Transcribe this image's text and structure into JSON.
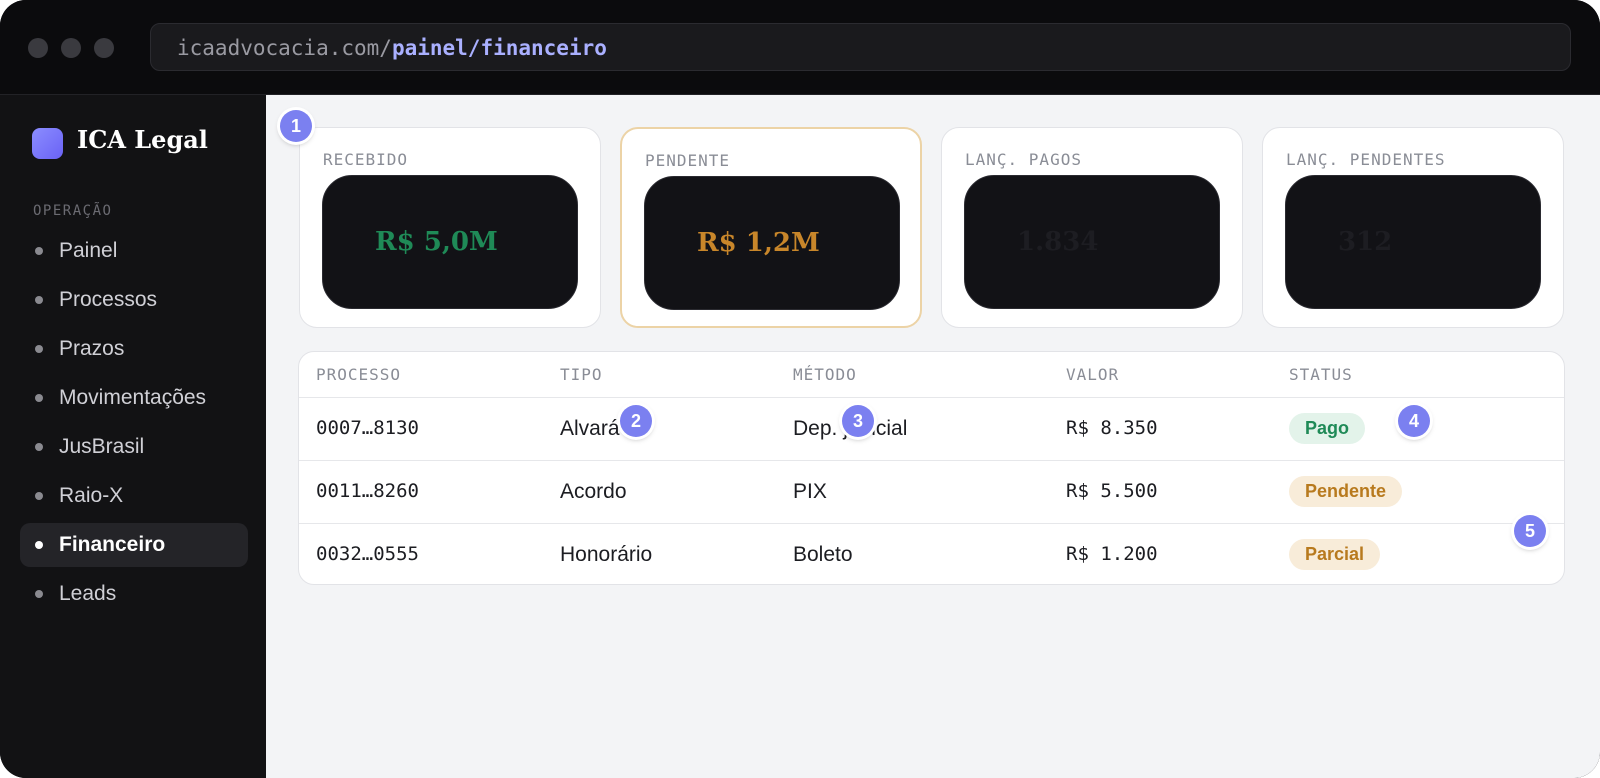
{
  "browser": {
    "url_host": "icaadvocacia.com/",
    "url_path": "painel/financeiro"
  },
  "sidebar": {
    "brand": "ICA Legal",
    "section": "OPERAÇÃO",
    "items": [
      {
        "label": "Painel",
        "active": false
      },
      {
        "label": "Processos",
        "active": false
      },
      {
        "label": "Prazos",
        "active": false
      },
      {
        "label": "Movimentações",
        "active": false
      },
      {
        "label": "JusBrasil",
        "active": false
      },
      {
        "label": "Raio-X",
        "active": false
      },
      {
        "label": "Financeiro",
        "active": true
      },
      {
        "label": "Leads",
        "active": false
      }
    ]
  },
  "stats": [
    {
      "label": "RECEBIDO",
      "value": "R$ 5,0M",
      "color": "#1f8a57"
    },
    {
      "label": "PENDENTE",
      "value": "R$ 1,2M",
      "color": "#c8862a"
    },
    {
      "label": "LANÇ. PAGOS",
      "value": "1.834",
      "color": "#1d1d22"
    },
    {
      "label": "LANÇ. PENDENTES",
      "value": "312",
      "color": "#1d1d22"
    }
  ],
  "table": {
    "columns": [
      "PROCESSO",
      "TIPO",
      "MÉTODO",
      "VALOR",
      "STATUS"
    ],
    "rows": [
      {
        "processo": "0007…8130",
        "tipo": "Alvará",
        "metodo": "Dep. judicial",
        "valor": "R$ 8.350",
        "status": "Pago"
      },
      {
        "processo": "0011…8260",
        "tipo": "Acordo",
        "metodo": "PIX",
        "valor": "R$ 5.500",
        "status": "Pendente"
      },
      {
        "processo": "0032…0555",
        "tipo": "Honorário",
        "metodo": "Boleto",
        "valor": "R$ 1.200",
        "status": "Parcial"
      }
    ]
  },
  "status_colors": {
    "Pago": {
      "bg": "#e3f3ea",
      "fg": "#1f8a57"
    },
    "Pendente": {
      "bg": "#f8ecd9",
      "fg": "#b87a1e"
    },
    "Parcial": {
      "bg": "#f8ecd9",
      "fg": "#b87a1e"
    }
  },
  "markers": [
    "1",
    "2",
    "3",
    "4",
    "5"
  ]
}
